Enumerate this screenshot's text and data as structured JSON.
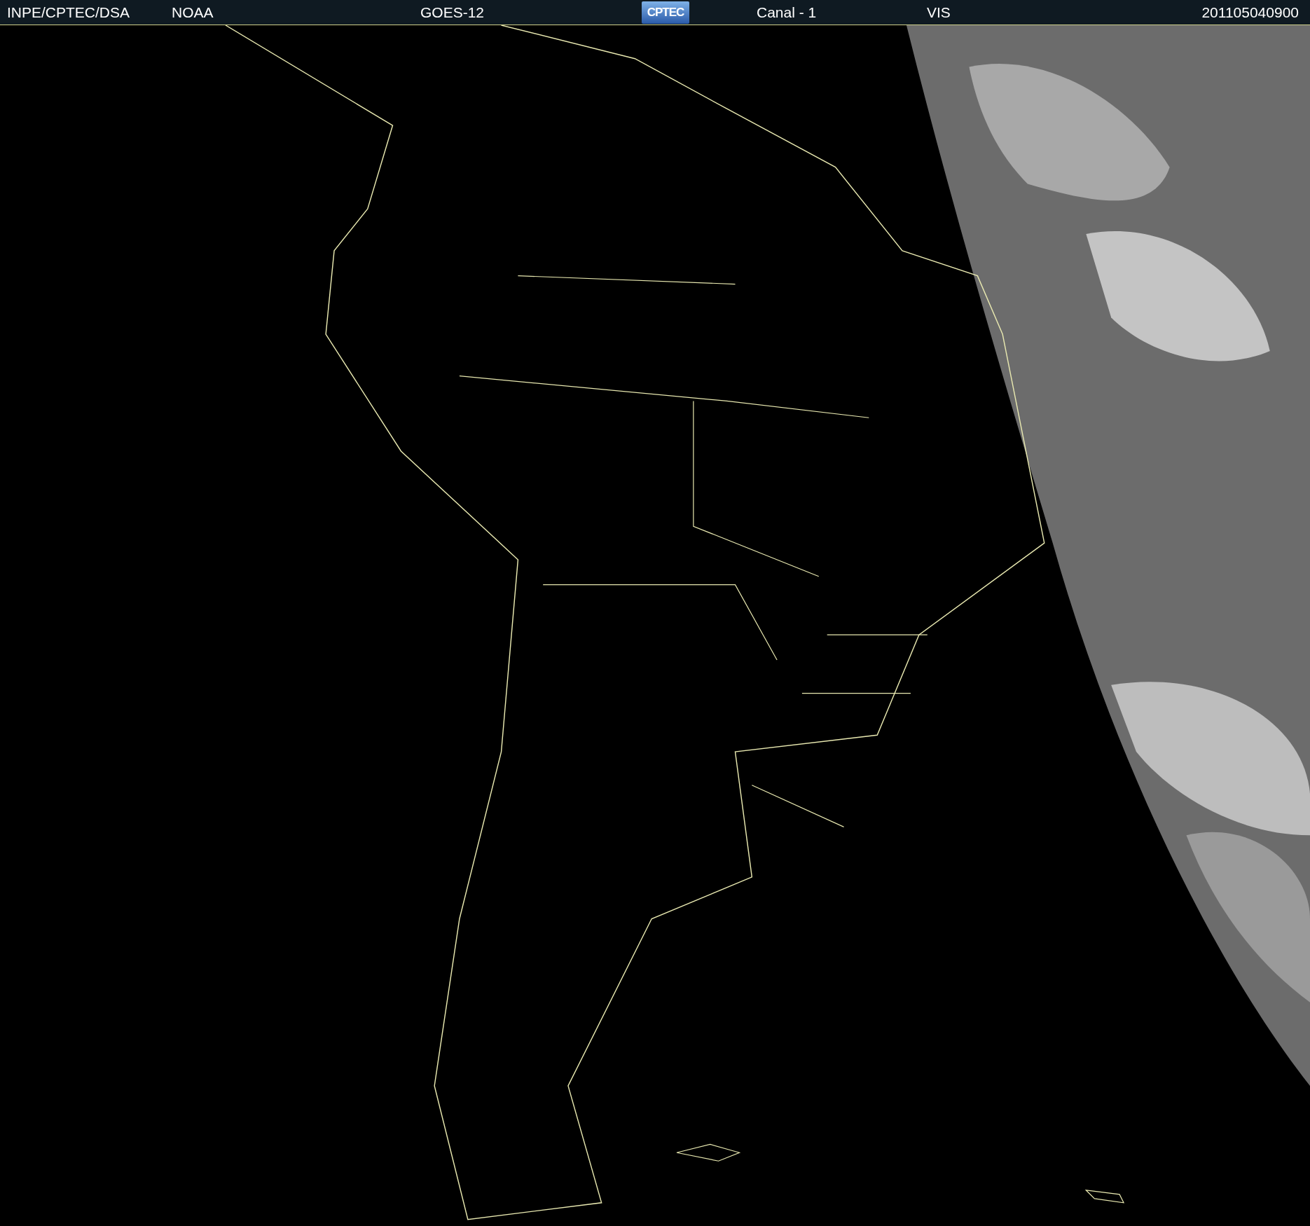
{
  "header": {
    "items": [
      {
        "kind": "text",
        "text": "INPE/CPTEC/DSA"
      },
      {
        "kind": "text",
        "text": "NOAA"
      },
      {
        "kind": "text",
        "text": "GOES-12"
      },
      {
        "kind": "logo",
        "text": "CPTEC"
      },
      {
        "kind": "text",
        "text": "Canal - 1"
      },
      {
        "kind": "text",
        "text": "VIS"
      },
      {
        "kind": "text",
        "text": "201105040900"
      }
    ]
  }
}
